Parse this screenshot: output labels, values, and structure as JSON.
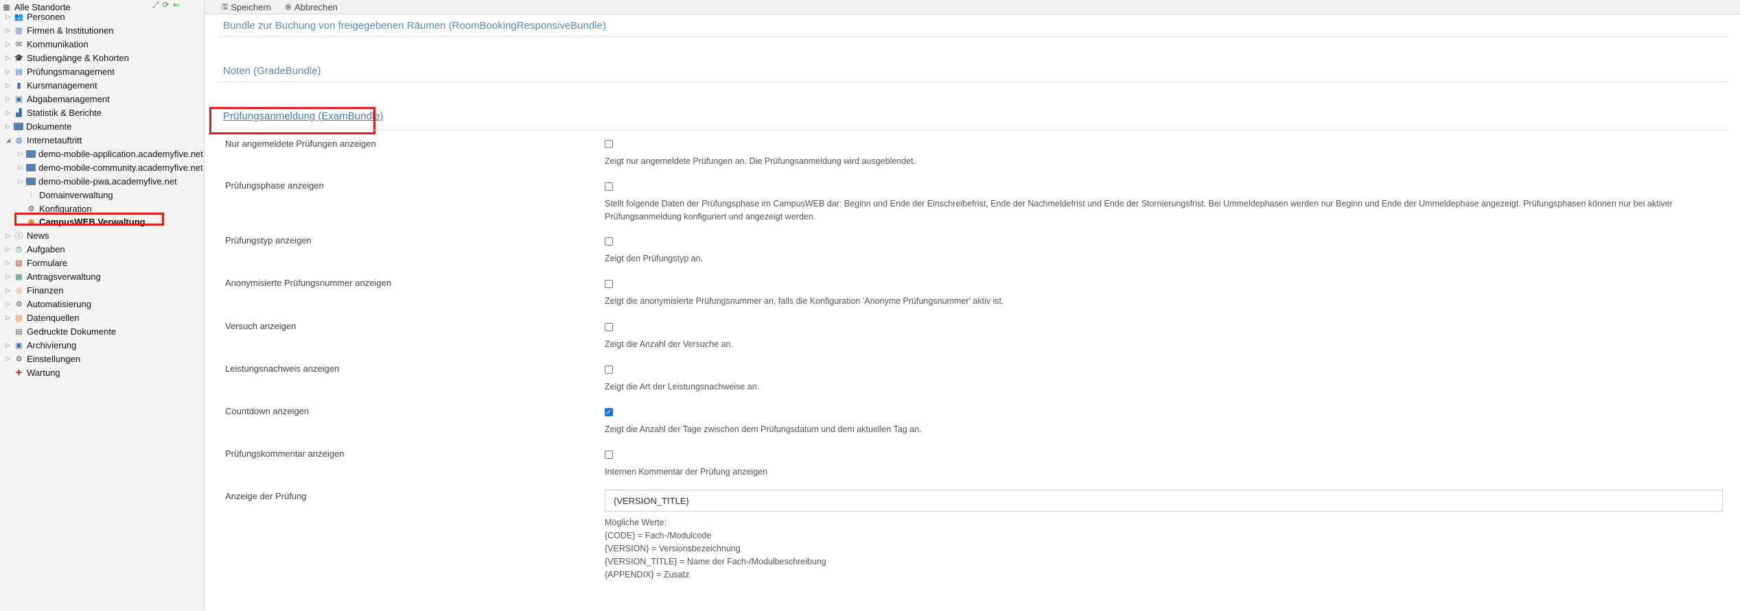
{
  "sidebar": {
    "root_label": "Alle Standorte",
    "items": [
      {
        "label": "Personen",
        "icon": "persons-icon"
      },
      {
        "label": "Firmen & Institutionen",
        "icon": "companies-icon"
      },
      {
        "label": "Kommunikation",
        "icon": "mail-icon"
      },
      {
        "label": "Studiengänge & Kohorten",
        "icon": "graduation-icon"
      },
      {
        "label": "Prüfungsmanagement",
        "icon": "exam-icon"
      },
      {
        "label": "Kursmanagement",
        "icon": "course-icon"
      },
      {
        "label": "Abgabemanagement",
        "icon": "submission-icon"
      },
      {
        "label": "Statistik & Berichte",
        "icon": "chart-icon"
      },
      {
        "label": "Dokumente",
        "icon": "folder-icon"
      },
      {
        "label": "Internetauftritt",
        "icon": "globe-icon"
      },
      {
        "label": "demo-mobile-application.academyfive.net",
        "icon": "folder-icon"
      },
      {
        "label": "demo-mobile-community.academyfive.net",
        "icon": "folder-icon"
      },
      {
        "label": "demo-mobile-pwa.academyfive.net",
        "icon": "folder-icon"
      },
      {
        "label": "Domainverwaltung",
        "icon": "sliders-icon"
      },
      {
        "label": "Konfiguration",
        "icon": "gear-icon"
      },
      {
        "label": "CampusWEB Verwaltung",
        "icon": "campusweb-icon"
      },
      {
        "label": "News",
        "icon": "info-icon"
      },
      {
        "label": "Aufgaben",
        "icon": "clock-icon"
      },
      {
        "label": "Formulare",
        "icon": "form-icon"
      },
      {
        "label": "Antragsverwaltung",
        "icon": "request-icon"
      },
      {
        "label": "Finanzen",
        "icon": "coins-icon"
      },
      {
        "label": "Automatisierung",
        "icon": "gear-icon"
      },
      {
        "label": "Datenquellen",
        "icon": "datasource-icon"
      },
      {
        "label": "Gedruckte Dokumente",
        "icon": "printed-doc-icon"
      },
      {
        "label": "Archivierung",
        "icon": "archive-icon"
      },
      {
        "label": "Einstellungen",
        "icon": "gear-icon"
      },
      {
        "label": "Wartung",
        "icon": "maintenance-icon"
      }
    ]
  },
  "toolbar": {
    "save_label": "Speichern",
    "cancel_label": "Abbrechen"
  },
  "sections": {
    "room_booking": "Bundle zur Buchung von freigegebenen Räumen (RoomBookingResponsiveBundle)",
    "grade": "Noten (GradeBundle)",
    "exam": "Prüfungsanmeldung (ExamBundle)"
  },
  "fields": [
    {
      "label": "Nur angemeldete Prüfungen anzeigen",
      "checked": false,
      "desc": "Zeigt nur angemeldete Prüfungen an. Die Prüfungsanmeldung wird ausgeblendet."
    },
    {
      "label": "Prüfungsphase anzeigen",
      "checked": false,
      "desc": "Stellt folgende Daten der Prüfungsphase im CampusWEB dar: Beginn und Ende der Einschreibefrist, Ende der Nachmeldefrist und Ende der Stornierungsfrist. Bei Ummeldephasen werden nur Beginn und Ende der Ummeldephase angezeigt. Prüfungsphasen können nur bei aktiver Prüfungsanmeldung konfiguriert und angezeigt werden."
    },
    {
      "label": "Prüfungstyp anzeigen",
      "checked": false,
      "desc": "Zeigt den Prüfungstyp an."
    },
    {
      "label": "Anonymisierte Prüfungsnummer anzeigen",
      "checked": false,
      "desc": "Zeigt die anonymisierte Prüfungsnummer an, falls die Konfiguration 'Anonyme Prüfungsnummer' aktiv ist."
    },
    {
      "label": "Versuch anzeigen",
      "checked": false,
      "desc": "Zeigt die Anzahl der Versuche an."
    },
    {
      "label": "Leistungsnachweis anzeigen",
      "checked": false,
      "desc": "Zeigt die Art der Leistungsnachweise an."
    },
    {
      "label": "Countdown anzeigen",
      "checked": true,
      "desc": "Zeigt die Anzahl der Tage zwischen dem Prüfungsdatum und dem aktuellen Tag an."
    },
    {
      "label": "Prüfungskommentar anzeigen",
      "checked": false,
      "desc": "Internen Kommentar der Prüfung anzeigen"
    }
  ],
  "display": {
    "label": "Anzeige der Prüfung",
    "value": "{VERSION_TITLE}",
    "possible_values_title": "Mögliche Werte:",
    "possible_values": [
      "{CODE} = Fach-/Modulcode",
      "{VERSION} = Versionsbezeichnung",
      "{VERSION_TITLE} = Name der Fach-/Modulbeschreibung",
      "{APPENDIX} = Zusatz"
    ]
  }
}
